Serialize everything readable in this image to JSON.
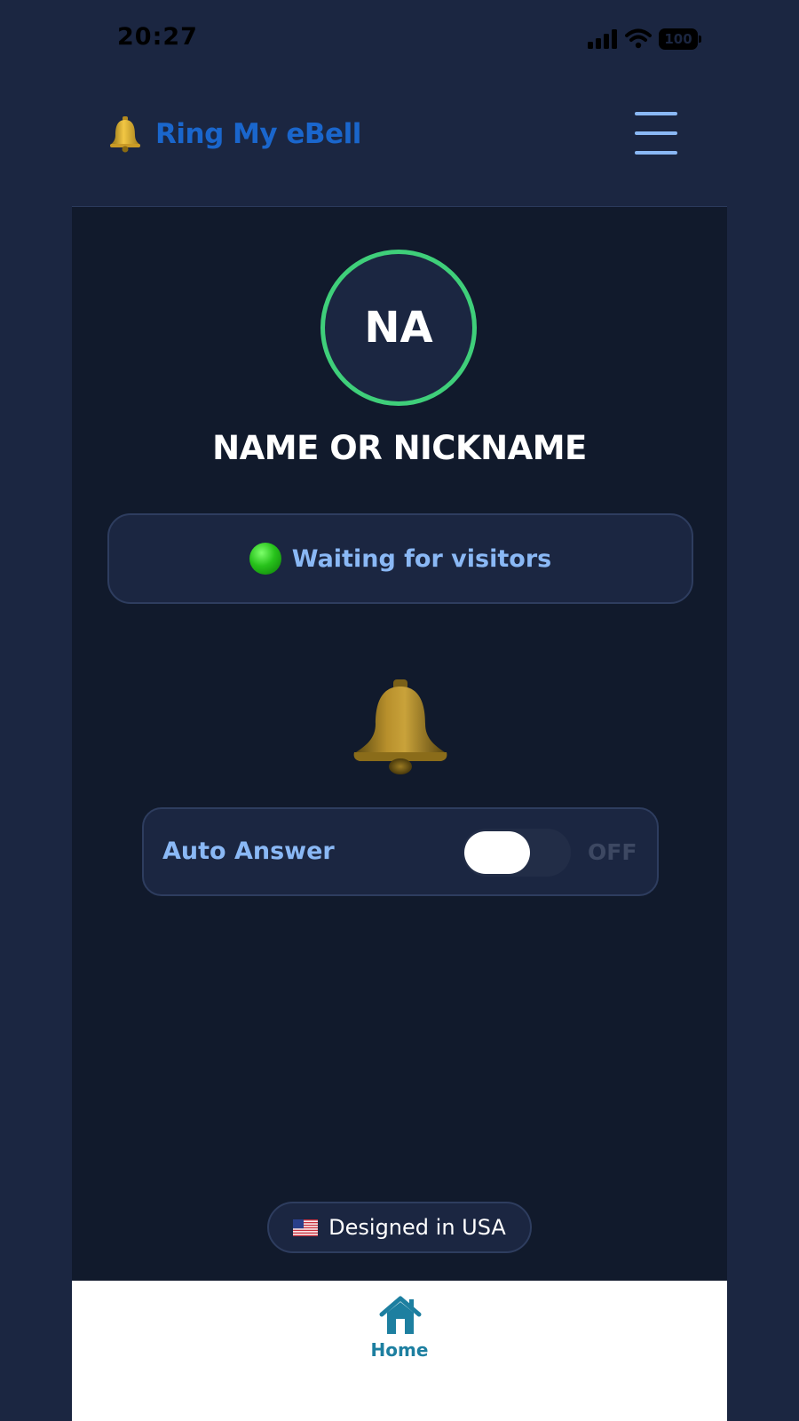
{
  "status_bar": {
    "time": "20:27",
    "battery": "100"
  },
  "header": {
    "brand_icon": "bell-icon",
    "brand_name": "Ring My eBell",
    "menu_icon": "hamburger-menu-icon"
  },
  "profile": {
    "initials": "NA",
    "name": "NAME OR NICKNAME",
    "ring_color": "#3fcf7a"
  },
  "status": {
    "indicator_icon": "green-circle-icon",
    "text": "Waiting for visitors"
  },
  "bell": {
    "icon": "bell-icon"
  },
  "auto_answer": {
    "label": "Auto Answer",
    "state": "OFF",
    "enabled": false
  },
  "footer_badge": {
    "flag_icon": "us-flag-icon",
    "text": "Designed in USA"
  },
  "bottom_nav": {
    "items": [
      {
        "label": "Home",
        "icon": "home-icon",
        "active": true
      }
    ]
  },
  "colors": {
    "page_bg": "#1b2641",
    "main_bg": "#111a2c",
    "brand": "#1a66cc",
    "accent_text": "#8ab8f5",
    "nav_active": "#1d7fa0"
  }
}
